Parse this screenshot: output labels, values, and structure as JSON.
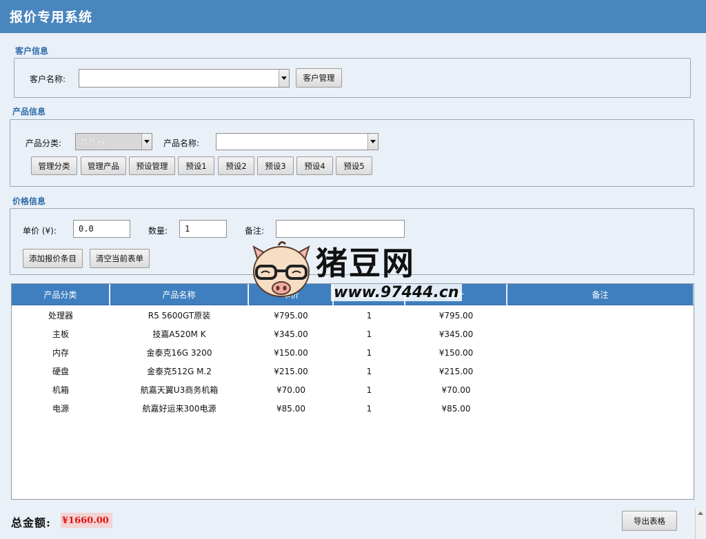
{
  "app": {
    "title": "报价专用系统",
    "accent": "#4a86be",
    "header_color": "#3f7fbf"
  },
  "customer": {
    "section_title": "客户信息",
    "name_label": "客户名称:",
    "name_value": "",
    "manage_button": "客户管理"
  },
  "product": {
    "section_title": "产品信息",
    "category_label": "产品分类:",
    "category_value": "散热器",
    "name_label": "产品名称:",
    "name_value": "",
    "buttons": [
      "管理分类",
      "管理产品",
      "预设管理",
      "预设1",
      "预设2",
      "预设3",
      "预设4",
      "预设5"
    ]
  },
  "price": {
    "section_title": "价格信息",
    "unit_price_label": "单价 (¥):",
    "unit_price_value": "0.0",
    "quantity_label": "数量:",
    "quantity_value": "1",
    "note_label": "备注:",
    "note_value": "",
    "add_button": "添加报价条目",
    "clear_button": "清空当前表单"
  },
  "table": {
    "headers": [
      "产品分类",
      "产品名称",
      "单价",
      "数量",
      "合计",
      "备注"
    ],
    "rows": [
      [
        "处理器",
        "R5 5600GT原装",
        "¥795.00",
        "1",
        "¥795.00",
        ""
      ],
      [
        "主板",
        "技嘉A520M K",
        "¥345.00",
        "1",
        "¥345.00",
        ""
      ],
      [
        "内存",
        "金泰克16G 3200",
        "¥150.00",
        "1",
        "¥150.00",
        ""
      ],
      [
        "硬盘",
        "金泰克512G M.2",
        "¥215.00",
        "1",
        "¥215.00",
        ""
      ],
      [
        "机箱",
        "航嘉天翼U3商务机箱",
        "¥70.00",
        "1",
        "¥70.00",
        ""
      ],
      [
        "电源",
        "航嘉好运来300电源",
        "¥85.00",
        "1",
        "¥85.00",
        ""
      ]
    ]
  },
  "footer": {
    "total_label": "总金额:",
    "total_value": "¥1660.00",
    "export_button": "导出表格"
  },
  "watermark": {
    "brand": "猪豆网",
    "url": "www.97444.cn"
  }
}
